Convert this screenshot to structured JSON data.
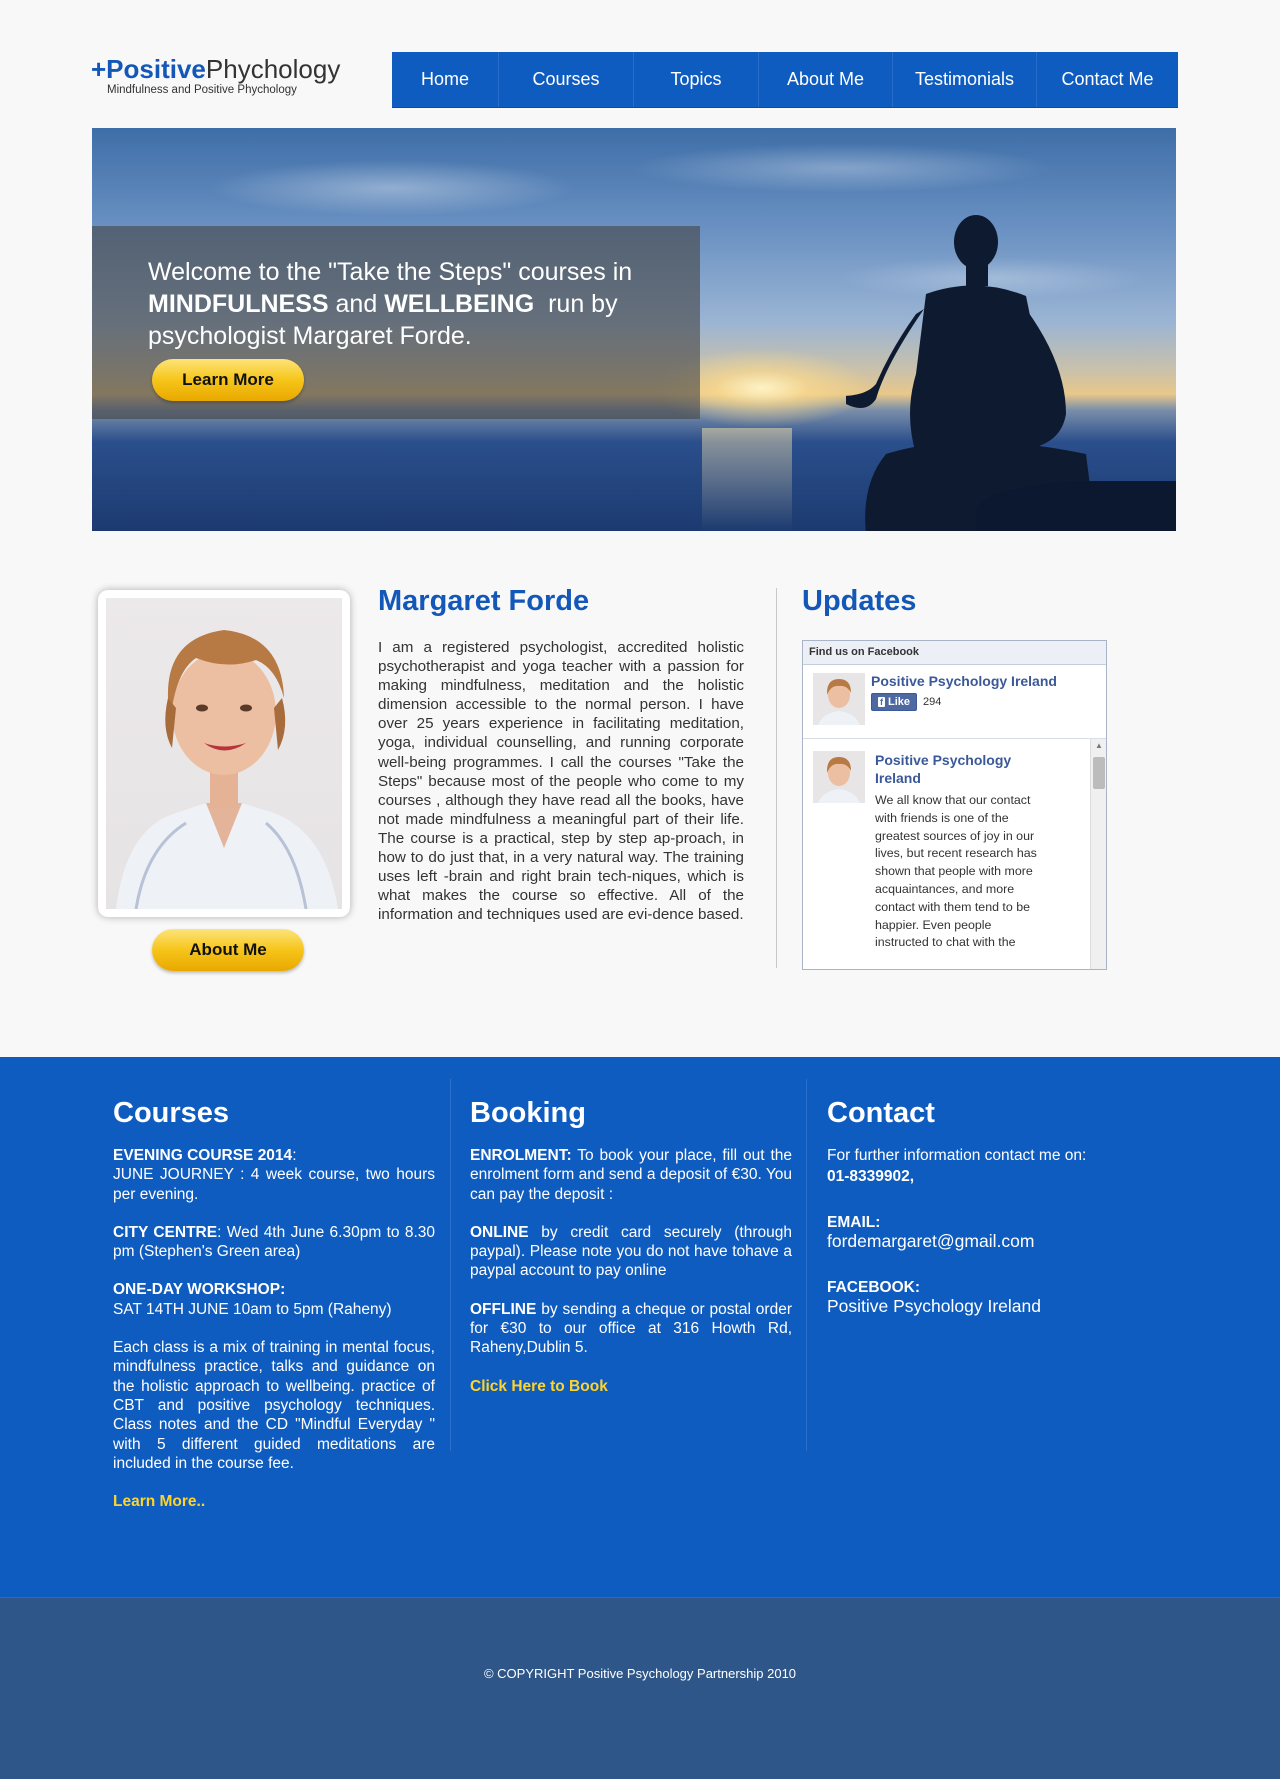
{
  "logo": {
    "positive": "+Positive",
    "phychology": "Phychology",
    "tagline": "Mindfulness and Positive Phychology"
  },
  "nav": [
    "Home",
    "Courses",
    "Topics",
    "About Me",
    "Testimonials",
    "Contact Me"
  ],
  "hero": {
    "line1": "Welcome to the \"Take the Steps\" courses in",
    "mindfulness": "MINDFULNESS",
    "and": "and",
    "wellbeing": "WELLBEING",
    "run_by": "run by",
    "line3": "psychologist Margaret Forde.",
    "button": "Learn More"
  },
  "profile": {
    "about_button": "About Me",
    "name": "Margaret Forde",
    "bio": "I am a registered psychologist, accredited holistic psychotherapist and yoga teacher with a passion for making mindfulness, meditation and the holistic dimension accessible to the normal person. I have over 25 years experience in facilitating meditation, yoga, individual counselling, and running corporate well-being programmes. I call the courses \"Take the Steps\" because most of the people who come to my courses , although they have read all the books, have not made mindfulness a meaningful part of their life. The course is a practical, step by step ap-proach, in how to do just that, in a very natural way. The training uses left -brain and right brain tech-niques, which is what makes the course so effective. All of the information and techniques used are evi-dence based."
  },
  "updates": {
    "title": "Updates",
    "fb_header": "Find us on Facebook",
    "page_name": "Positive Psychology Ireland",
    "like": "Like",
    "like_count": "294",
    "post_name": "Positive Psychology Ireland",
    "post_text": "We all know that our contact with friends is one of the greatest sources of joy in our lives, but recent research has shown that people with more acquaintances, and more contact with them tend to be happier. Even people instructed to chat with the"
  },
  "courses": {
    "title": "Courses",
    "p1_bold": "EVENING COURSE 2014",
    "p1_rest": ":",
    "p1_line2": "JUNE JOURNEY : 4 week course, two hours per evening.",
    "p2_bold": "CITY CENTRE",
    "p2_rest": ": Wed 4th June 6.30pm to 8.30 pm  (Stephen's Green area)",
    "p3_bold": "ONE-DAY WORKSHOP:",
    "p3_line2": "SAT 14TH JUNE 10am to 5pm (Raheny)",
    "p4": "Each class is a mix of training in mental focus, mindfulness practice, talks and guidance on the holistic approach to wellbeing. practice of CBT and positive psychology techniques. Class notes and the CD \"Mindful Everyday \" with 5 different guided meditations  are included in the course fee.",
    "link": "Learn More.."
  },
  "booking": {
    "title": "Booking",
    "p1_bold": "ENROLMENT:",
    "p1_rest": " To book your place, fill out the enrolment form and send a deposit of €30. You can pay the deposit :",
    "p2_bold": "ONLINE",
    "p2_rest": " by credit card securely (through paypal). Please note you do not have tohave a paypal account to pay online",
    "p3_bold": "OFFLINE",
    "p3_rest": " by sending a cheque or postal order for €30 to our office at 316 Howth Rd, Raheny,Dublin 5.",
    "link": "Click Here to Book"
  },
  "contact": {
    "title": "Contact",
    "intro": "For further information contact me on:",
    "phone": "01-8339902,",
    "email_label": "EMAIL:",
    "email": "fordemargaret@gmail.com",
    "facebook_label": "FACEBOOK:",
    "facebook": "Positive Psychology Ireland"
  },
  "copyright": "© COPYRIGHT Positive Psychology Partnership 2010"
}
